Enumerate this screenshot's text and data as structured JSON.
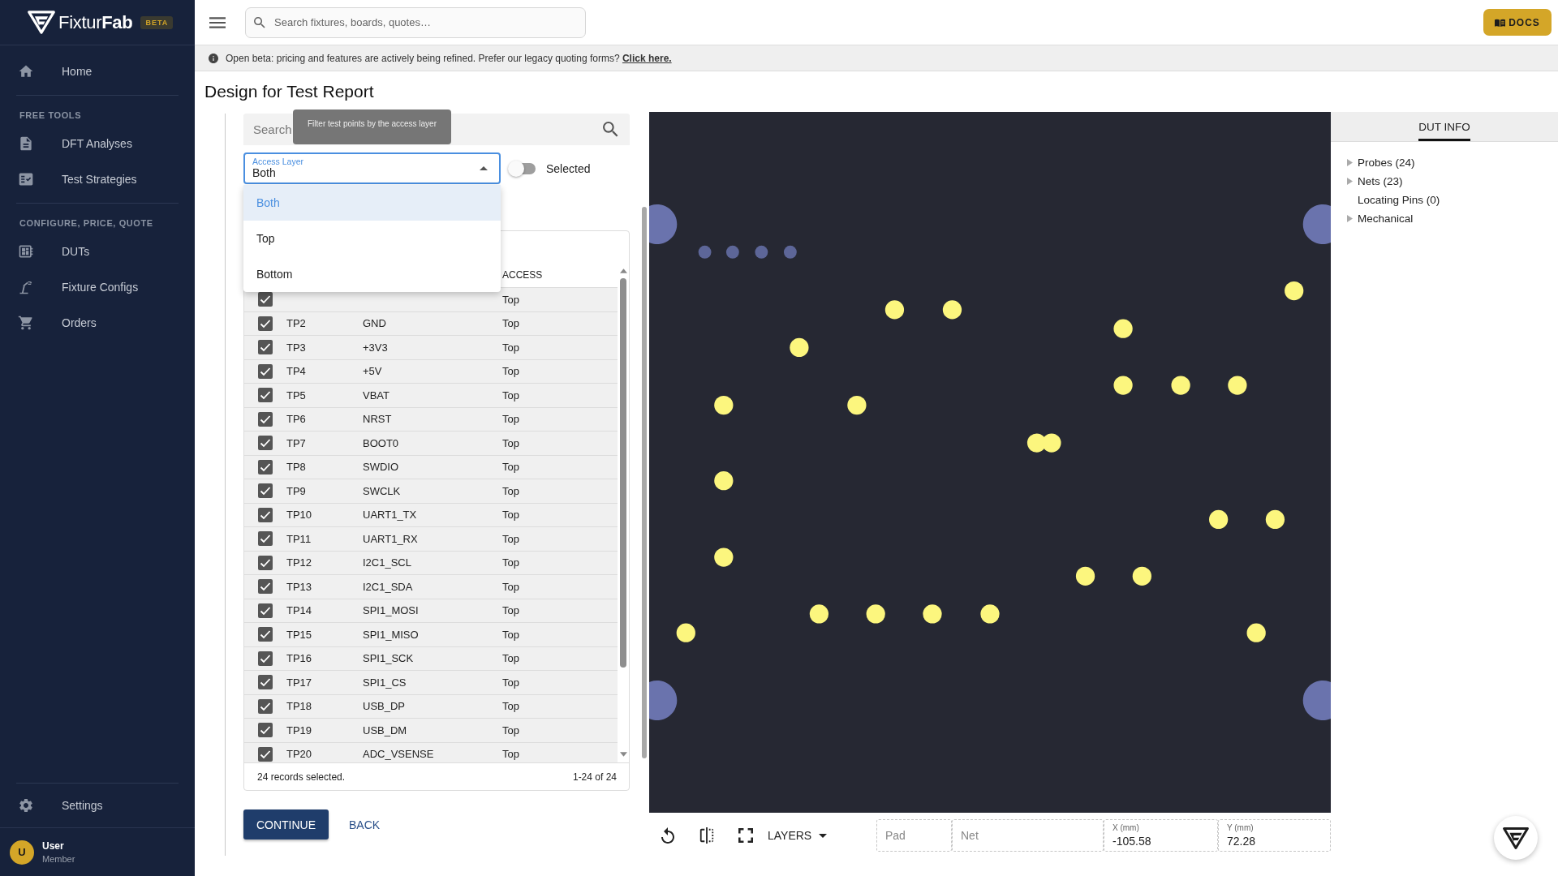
{
  "sidebar": {
    "logo": "Fixtur**Fab**",
    "badge": "BETA",
    "sections": [
      {
        "items": [
          {
            "label": "Home",
            "selected": false
          }
        ]
      },
      {
        "heading": "FREE TOOLS",
        "items": [
          {
            "label": "DFT Analyses",
            "selected": false
          },
          {
            "label": "Test Strategies",
            "selected": false
          }
        ]
      },
      {
        "heading": "CONFIGURE, PRICE, QUOTE",
        "items": [
          {
            "label": "DUTs",
            "selected": false
          },
          {
            "label": "Fixture Configs",
            "selected": false
          },
          {
            "label": "Orders",
            "selected": false
          }
        ]
      }
    ],
    "footer_items": [
      {
        "label": "Settings",
        "selected": false
      }
    ],
    "user": {
      "initial": "U",
      "name": "User",
      "role": "Member"
    }
  },
  "topbar": {
    "search": {
      "placeholder": "Search fixtures, boards, quotes…"
    },
    "docs_button": "DOCS"
  },
  "banner": {
    "text": "Open beta: pricing and features are actively being refined. Prefer our legacy quoting forms?",
    "link": "Click here."
  },
  "page_title": "Design for Test Report",
  "test_points": {
    "search": {
      "placeholder": "Search"
    },
    "tooltip": "Filter test points by the access layer",
    "access_layer": {
      "label": "Access Layer",
      "value": "Both",
      "expanded": true,
      "options": [
        {
          "label": "Both",
          "selected": true
        },
        {
          "label": "Top",
          "selected": false
        },
        {
          "label": "Bottom",
          "selected": false
        }
      ]
    },
    "selected_toggle": {
      "label": "Selected",
      "on": false
    },
    "table": {
      "columns": [
        "ACCESS"
      ],
      "rows": [
        {
          "checked": true,
          "access": "Top"
        },
        {
          "checked": true,
          "id": "TP2",
          "net": "GND",
          "access": "Top"
        },
        {
          "checked": true,
          "id": "TP3",
          "net": "+3V3",
          "access": "Top"
        },
        {
          "checked": true,
          "id": "TP4",
          "net": "+5V",
          "access": "Top"
        },
        {
          "checked": true,
          "id": "TP5",
          "net": "VBAT",
          "access": "Top"
        },
        {
          "checked": true,
          "id": "TP6",
          "net": "NRST",
          "access": "Top"
        },
        {
          "checked": true,
          "id": "TP7",
          "net": "BOOT0",
          "access": "Top"
        },
        {
          "checked": true,
          "id": "TP8",
          "net": "SWDIO",
          "access": "Top"
        },
        {
          "checked": true,
          "id": "TP9",
          "net": "SWCLK",
          "access": "Top"
        },
        {
          "checked": true,
          "id": "TP10",
          "net": "UART1_TX",
          "access": "Top"
        },
        {
          "checked": true,
          "id": "TP11",
          "net": "UART1_RX",
          "access": "Top"
        },
        {
          "checked": true,
          "id": "TP12",
          "net": "I2C1_SCL",
          "access": "Top"
        },
        {
          "checked": true,
          "id": "TP13",
          "net": "I2C1_SDA",
          "access": "Top"
        },
        {
          "checked": true,
          "id": "TP14",
          "net": "SPI1_MOSI",
          "access": "Top"
        },
        {
          "checked": true,
          "id": "TP15",
          "net": "SPI1_MISO",
          "access": "Top"
        },
        {
          "checked": true,
          "id": "TP16",
          "net": "SPI1_SCK",
          "access": "Top"
        },
        {
          "checked": true,
          "id": "TP17",
          "net": "SPI1_CS",
          "access": "Top"
        },
        {
          "checked": true,
          "id": "TP18",
          "net": "USB_DP",
          "access": "Top"
        },
        {
          "checked": true,
          "id": "TP19",
          "net": "USB_DM",
          "access": "Top"
        },
        {
          "checked": true,
          "id": "TP20",
          "net": "ADC_VSENSE",
          "access": "Top"
        }
      ]
    },
    "footer": {
      "selection": "24 records selected.",
      "range": "1-24 of 24"
    }
  },
  "buttons": [
    {
      "label": "CONTINUE",
      "kind": "primary"
    },
    {
      "label": "BACK",
      "kind": "text"
    }
  ],
  "board_view": {
    "layers_button": "LAYERS",
    "fields": [
      {
        "placeholder": "Pad"
      },
      {
        "placeholder": "Net"
      },
      {
        "label": "X (mm)",
        "value": "-105.58"
      },
      {
        "label": "Y (mm)",
        "value": "72.28"
      }
    ]
  },
  "dut_info": {
    "tabs": [
      {
        "label": "DUT INFO",
        "selected": true
      }
    ],
    "tree": [
      {
        "label": "Probes (24)",
        "expandable": true,
        "expanded": false
      },
      {
        "label": "Nets (23)",
        "expandable": true,
        "expanded": false
      },
      {
        "label": "Locating Pins (0)",
        "expandable": false
      },
      {
        "label": "Mechanical",
        "expandable": true,
        "expanded": false
      }
    ]
  }
}
